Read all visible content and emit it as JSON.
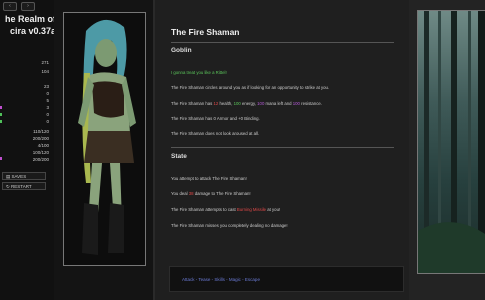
{
  "app": {
    "title_lines": [
      "he Realm of",
      "cira v0.37a"
    ],
    "nav_left": "‹",
    "nav_right": "›"
  },
  "sidebar": {
    "stats": [
      "271",
      "104",
      "23",
      "0",
      "5",
      "3",
      "0",
      "0",
      "110/120",
      "200/200",
      "4/100",
      "100/120",
      "200/200"
    ],
    "saves_label": "SAVES",
    "restart_label": "RESTART"
  },
  "main": {
    "enemy_title": "The Fire Shaman",
    "goblin_heading": "Goblin",
    "goblin_line": "I gonna treat you like a Rittel!",
    "intro_line": "The Fire Shaman circles around you as if looking for an opportunity to strike at you.",
    "stats_line": {
      "a": "The Fire Shaman has ",
      "health": "12",
      "b": " health, ",
      "energy": "100",
      "c": " energy, ",
      "mana": "100",
      "d": " mana left and ",
      "resist": "100",
      "e": " resistance."
    },
    "armor_line": "The Fire Shaman has 0 Armor and +0 Binding.",
    "aroused_line": "The Fire Shaman does not look aroused at all.",
    "state_heading": "State",
    "attack_line": "You attempt to attack The Fire Shaman!",
    "damage_line": {
      "a": "You deal ",
      "value": "38",
      "b": " damage to The Fire Shaman!"
    },
    "cast_line": {
      "a": "The Fire Shaman attempts to cast ",
      "spell": "Burning Missile",
      "b": " at you!"
    },
    "miss_line": "The Fire Shaman misses you completely dealing no damage!"
  },
  "actions": {
    "label": "Attack - Tease - Skills - Magic - Escape"
  },
  "colors": {
    "health": "#e04848",
    "energy": "#5bc65b",
    "mana": "#b45bd6",
    "link": "#6b7bd6"
  }
}
